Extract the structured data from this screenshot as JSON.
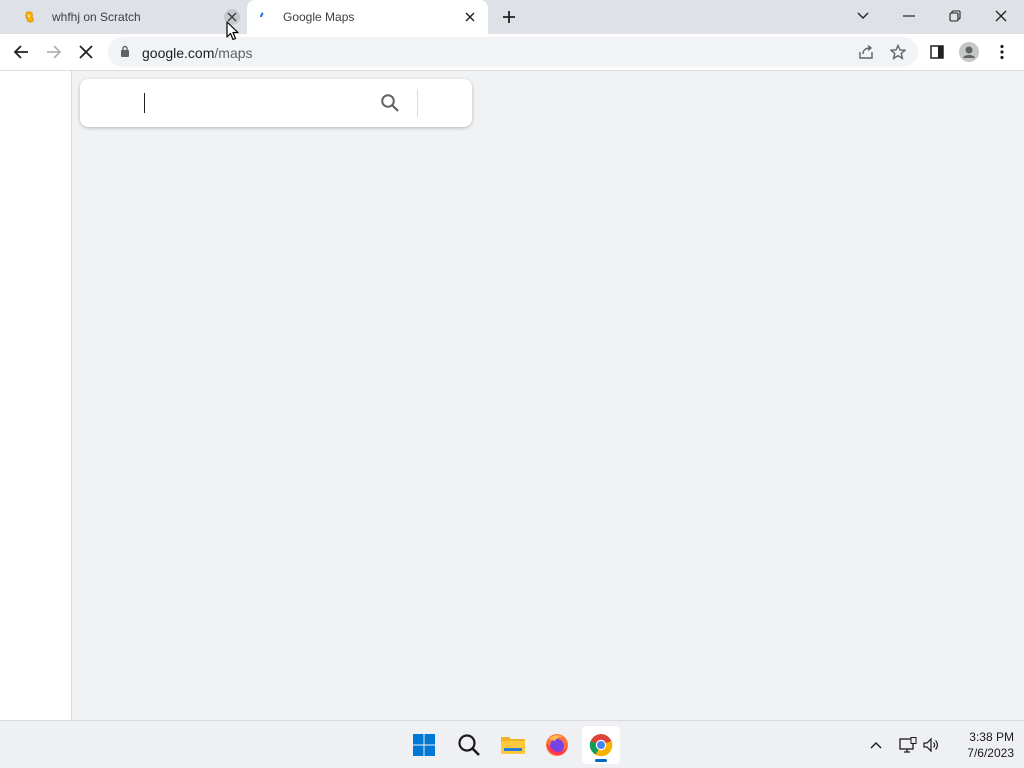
{
  "tabs": [
    {
      "title": "whfhj on Scratch",
      "favicon": "scratch-cat-icon",
      "active": false
    },
    {
      "title": "Google Maps",
      "favicon": "loading-spinner-icon",
      "active": true
    }
  ],
  "window_controls": [
    "tab-search",
    "minimize",
    "restore",
    "close"
  ],
  "toolbar": {
    "url_host": "google.com",
    "url_path": "/maps"
  },
  "maps": {
    "search_value": "",
    "search_placeholder": ""
  },
  "taskbar": {
    "apps": [
      "start-icon",
      "search-icon",
      "file-explorer-icon",
      "firefox-icon",
      "chrome-icon"
    ],
    "active_app": "chrome-icon",
    "time": "3:38 PM",
    "date": "7/6/2023"
  },
  "colors": {
    "accent": "#0067c0",
    "tabstrip": "#dee1e6",
    "page_bg": "#f0f2f4"
  }
}
